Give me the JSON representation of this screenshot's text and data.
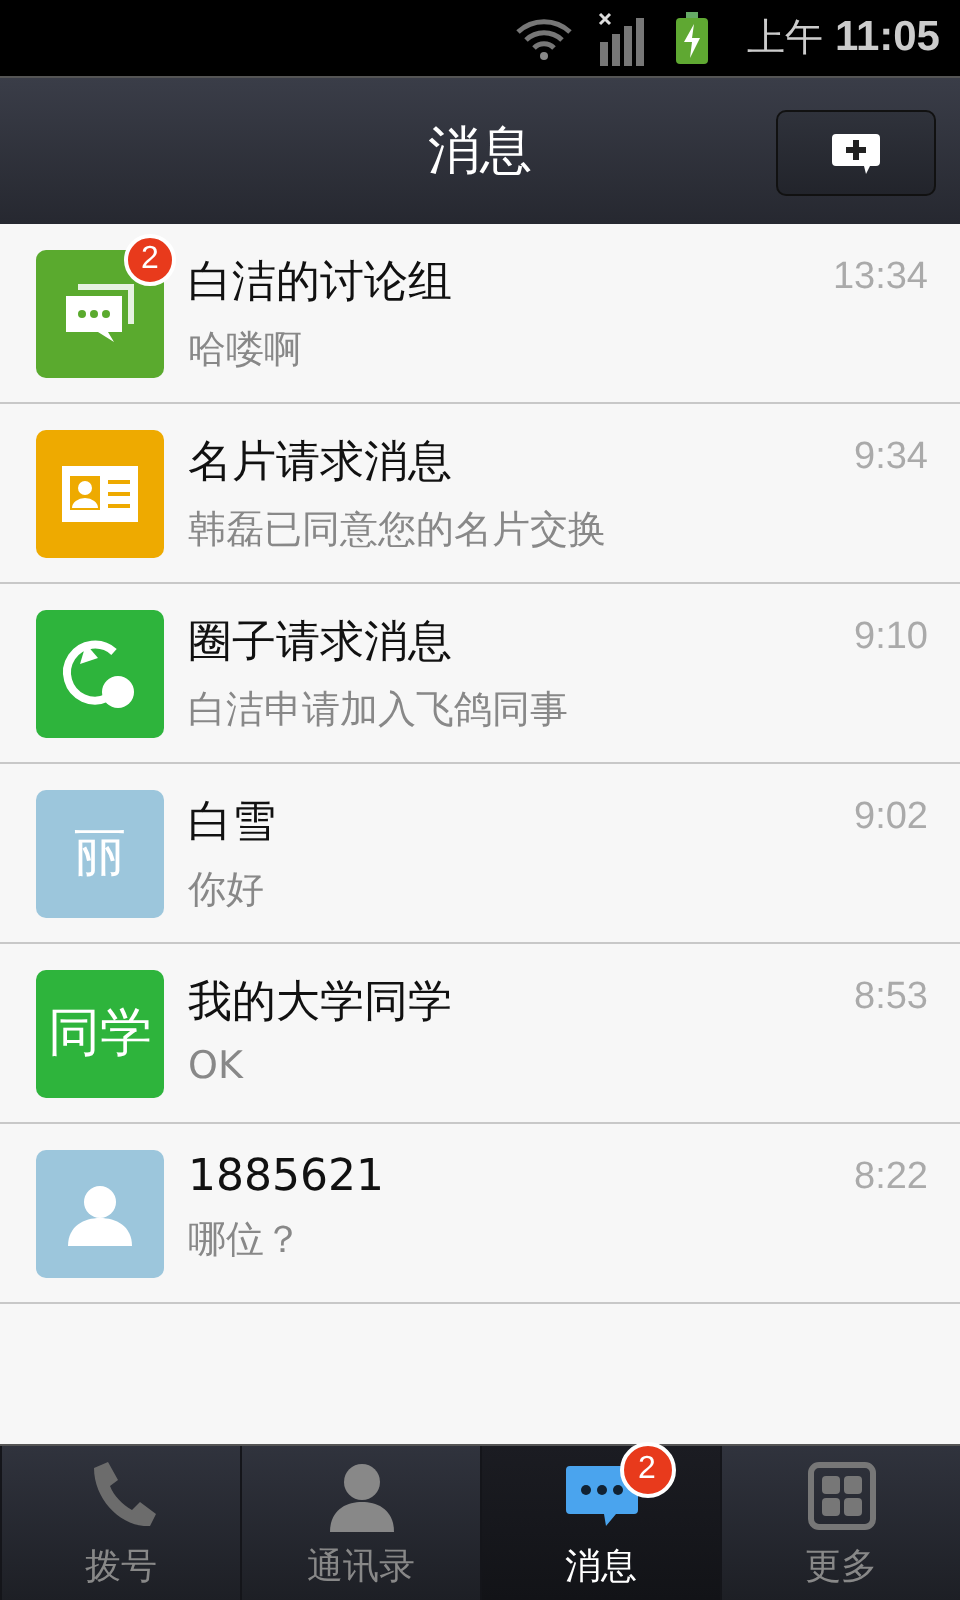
{
  "status_bar": {
    "time_prefix": "上午",
    "time": "11:05"
  },
  "header": {
    "title": "消息"
  },
  "conversations": [
    {
      "kind": "group",
      "color": "#5aaa2e",
      "badge": "2",
      "name": "白洁的讨论组",
      "preview": "哈喽啊",
      "time": "13:34"
    },
    {
      "kind": "card",
      "color": "#eeaa00",
      "name": "名片请求消息",
      "preview": "韩磊已同意您的名片交换",
      "time": "9:34"
    },
    {
      "kind": "circle",
      "color": "#2eb43c",
      "name": "圈子请求消息",
      "preview": "白洁申请加入飞鸽同事",
      "time": "9:10"
    },
    {
      "kind": "text",
      "color": "#9cc6dc",
      "avatar_text": "丽",
      "name": "白雪",
      "preview": "你好",
      "time": "9:02"
    },
    {
      "kind": "text",
      "color": "#2eb43c",
      "avatar_text": "同学",
      "name": "我的大学同学",
      "preview": "OK",
      "time": "8:53"
    },
    {
      "kind": "person",
      "color": "#9cc6dc",
      "name": "1885621",
      "preview": "哪位？",
      "time": "8:22"
    }
  ],
  "tabs": [
    {
      "kind": "phone",
      "label": "拨号",
      "selected": false
    },
    {
      "kind": "contacts",
      "label": "通讯录",
      "selected": false
    },
    {
      "kind": "messages",
      "label": "消息",
      "selected": true,
      "badge": "2"
    },
    {
      "kind": "more",
      "label": "更多",
      "selected": false
    }
  ]
}
